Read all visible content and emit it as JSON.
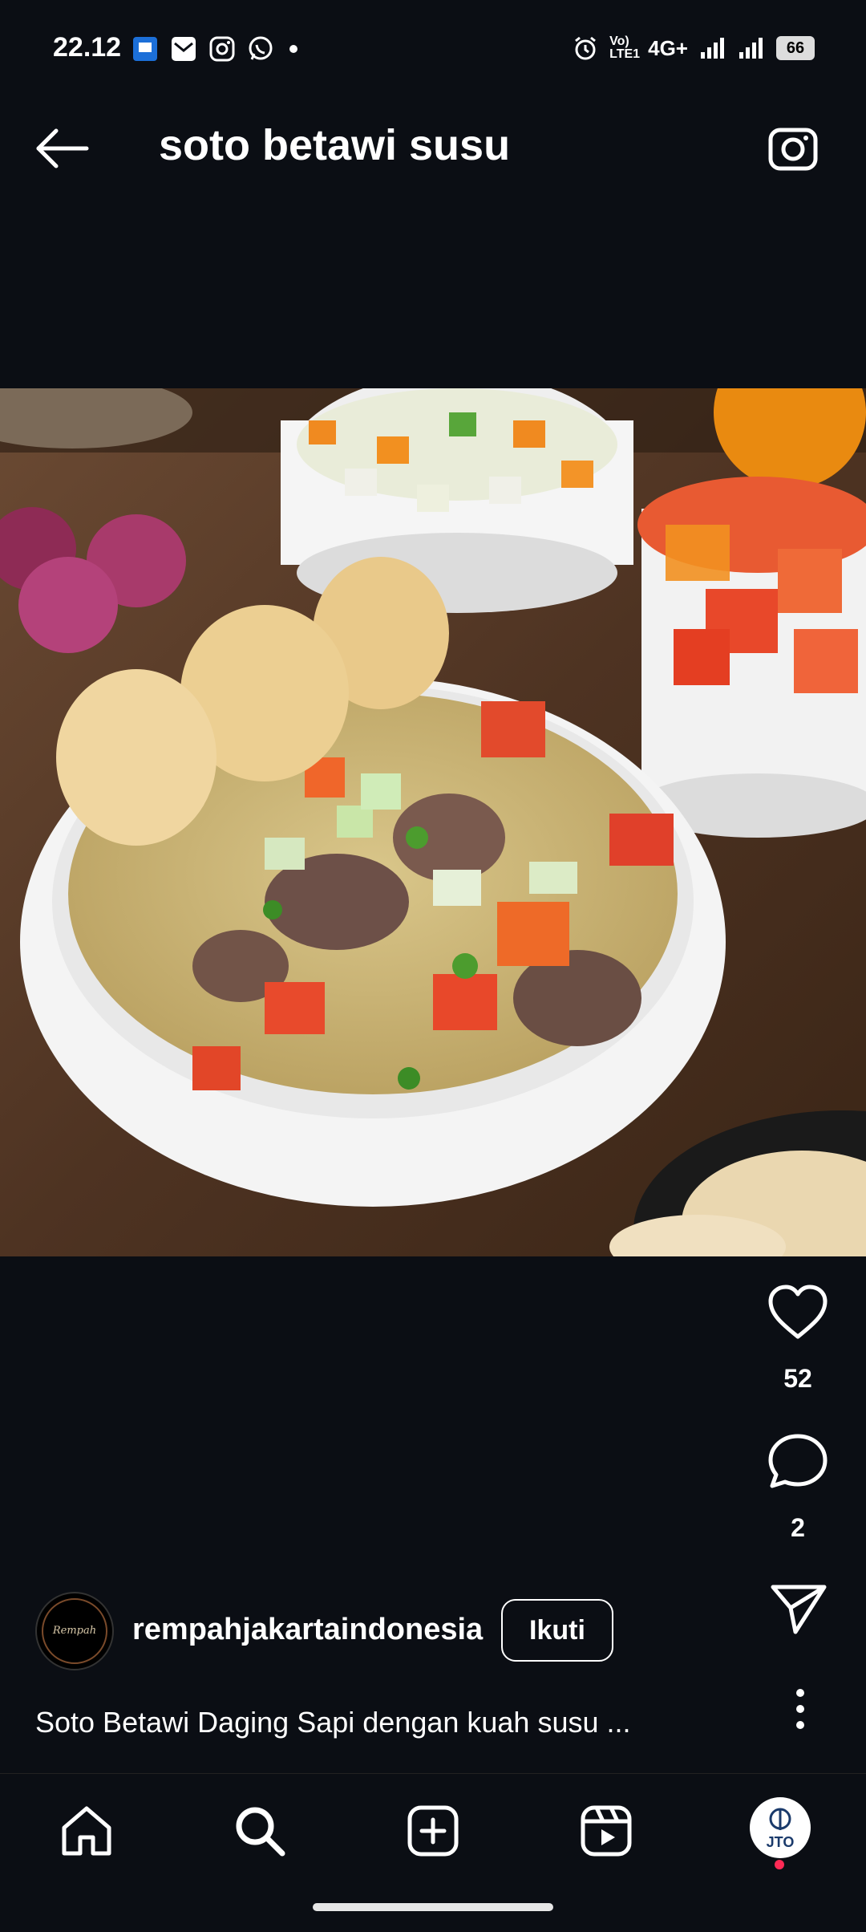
{
  "status_bar": {
    "time": "22.12",
    "network": "4G+",
    "volte": "Vo) LTE1",
    "battery": "66"
  },
  "header": {
    "title": "soto betawi susu"
  },
  "post": {
    "likes": "52",
    "comments": "2",
    "username": "rempahjakartaindonesia",
    "follow_label": "Ikuti",
    "caption": "Soto Betawi Daging Sapi dengan kuah susu ...",
    "avatar_text": "Rempah Jakarta"
  },
  "profile": {
    "badge_text": "JTO"
  },
  "colors": {
    "background": "#0b0e14",
    "text": "#ffffff",
    "notification": "#ff2a55"
  },
  "icons": {
    "back": "arrow-left-icon",
    "camera": "camera-icon",
    "like": "heart-icon",
    "comment": "comment-icon",
    "share": "send-icon",
    "more": "more-vertical-icon",
    "home": "home-icon",
    "search": "search-icon",
    "create": "plus-square-icon",
    "reels": "reels-icon"
  }
}
